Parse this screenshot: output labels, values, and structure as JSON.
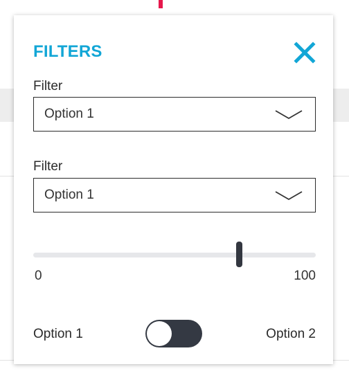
{
  "colors": {
    "accent": "#12a6d6",
    "dark": "#343943",
    "track": "#e6e7ea",
    "marker": "#e6184c"
  },
  "panel": {
    "title": "FILTERS",
    "close_icon": "close-icon"
  },
  "filters": [
    {
      "label": "Filter",
      "value": "Option 1",
      "icon": "chevron-down-icon"
    },
    {
      "label": "Filter",
      "value": "Option 1",
      "icon": "chevron-down-icon"
    }
  ],
  "slider": {
    "min_label": "0",
    "max_label": "100",
    "value": 73
  },
  "toggle": {
    "left_label": "Option 1",
    "right_label": "Option 2",
    "state": "off"
  }
}
